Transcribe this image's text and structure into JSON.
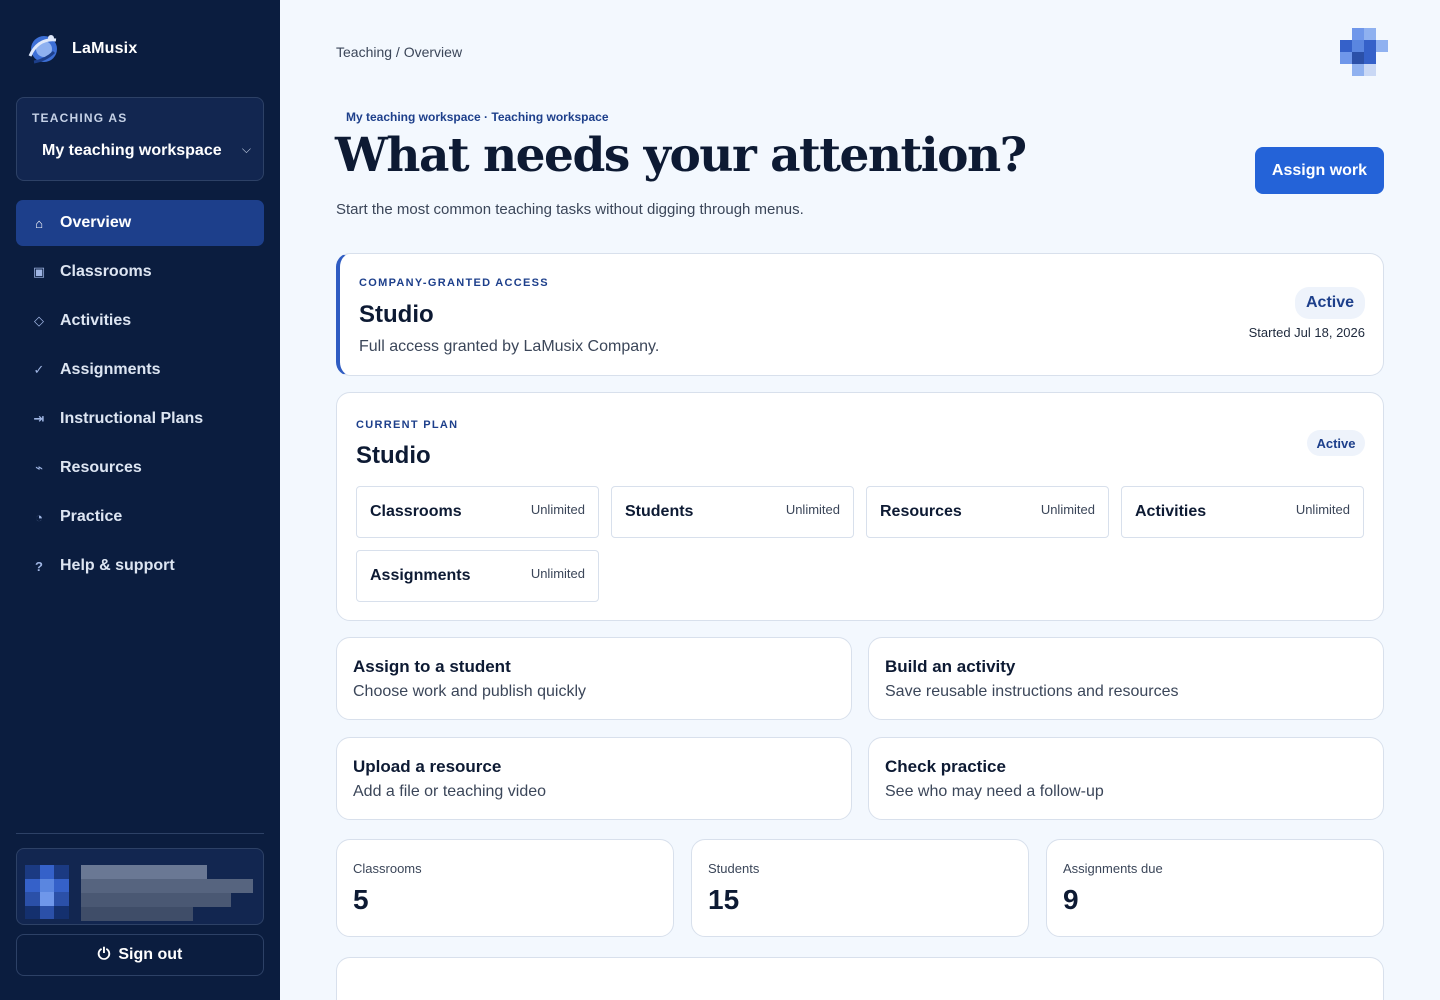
{
  "sidebar": {
    "brand": "LaMusix",
    "workspace": {
      "label": "TEACHING AS",
      "value": "My teaching workspace"
    },
    "items": [
      {
        "label": "Overview",
        "icon": "home-icon",
        "glyph": "⌂",
        "active": true
      },
      {
        "label": "Classrooms",
        "icon": "classroom-icon",
        "glyph": "▣"
      },
      {
        "label": "Activities",
        "icon": "diamond-icon",
        "glyph": "◇"
      },
      {
        "label": "Assignments",
        "icon": "check-icon",
        "glyph": "✓"
      },
      {
        "label": "Instructional Plans",
        "icon": "arrow-to-bar-icon",
        "glyph": "⇥"
      },
      {
        "label": "Resources",
        "icon": "link-icon",
        "glyph": "⌁"
      },
      {
        "label": "Practice",
        "icon": "clock-icon",
        "glyph": "◔"
      },
      {
        "label": "Help & support",
        "icon": "question-icon",
        "glyph": "?"
      }
    ],
    "sign_out": "Sign out"
  },
  "header": {
    "breadcrumb": "Teaching / Overview",
    "eyebrow": "My teaching workspace · Teaching workspace",
    "title": "What needs your attention?",
    "subtitle": "Start the most common teaching tasks without digging through menus.",
    "primary_action": "Assign work"
  },
  "access": {
    "kicker": "COMPANY-GRANTED ACCESS",
    "plan": "Studio",
    "description": "Full access granted by LaMusix Company.",
    "status": "Active",
    "started": "Started Jul 18, 2026"
  },
  "plan": {
    "kicker": "CURRENT PLAN",
    "name": "Studio",
    "status": "Active",
    "limits": [
      {
        "name": "Classrooms",
        "value": "Unlimited"
      },
      {
        "name": "Students",
        "value": "Unlimited"
      },
      {
        "name": "Resources",
        "value": "Unlimited"
      },
      {
        "name": "Activities",
        "value": "Unlimited"
      },
      {
        "name": "Assignments",
        "value": "Unlimited"
      }
    ]
  },
  "tasks": [
    {
      "title": "Assign to a student",
      "desc": "Choose work and publish quickly"
    },
    {
      "title": "Build an activity",
      "desc": "Save reusable instructions and resources"
    },
    {
      "title": "Upload a resource",
      "desc": "Add a file or teaching video"
    },
    {
      "title": "Check practice",
      "desc": "See who may need a follow-up"
    }
  ],
  "stats": [
    {
      "label": "Classrooms",
      "value": "5"
    },
    {
      "label": "Students",
      "value": "15"
    },
    {
      "label": "Assignments due",
      "value": "9"
    }
  ],
  "colors": {
    "sidebar_bg": "#0b1d3f",
    "accent": "#2463d8",
    "active_nav": "#1d3f8b",
    "page_bg": "#f3f8fe"
  }
}
